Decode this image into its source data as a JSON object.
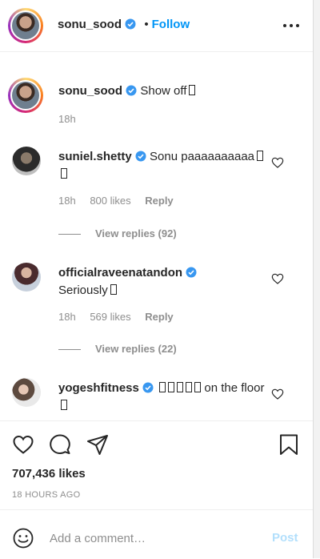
{
  "header": {
    "username": "sonu_sood",
    "separator": "•",
    "follow_label": "Follow"
  },
  "caption": {
    "username": "sonu_sood",
    "text": "Show off",
    "time": "18h"
  },
  "comments": [
    {
      "username": "suniel.shetty",
      "text": "Sonu paaaaaaaaaa",
      "time": "18h",
      "likes": "800 likes",
      "reply": "Reply",
      "view_replies": "View replies (92)"
    },
    {
      "username": "officialraveenatandon",
      "text": "Seriously",
      "time": "18h",
      "likes": "569 likes",
      "reply": "Reply",
      "view_replies": "View replies (22)"
    },
    {
      "username": "yogeshfitness",
      "text": "on the floor"
    }
  ],
  "post": {
    "likes": "707,436 likes",
    "time": "18 HOURS AGO"
  },
  "add_comment": {
    "placeholder": "Add a comment…",
    "post_label": "Post"
  },
  "colors": {
    "accent": "#0095f6",
    "post_disabled": "#b2dffc",
    "muted": "#8e8e8e"
  }
}
